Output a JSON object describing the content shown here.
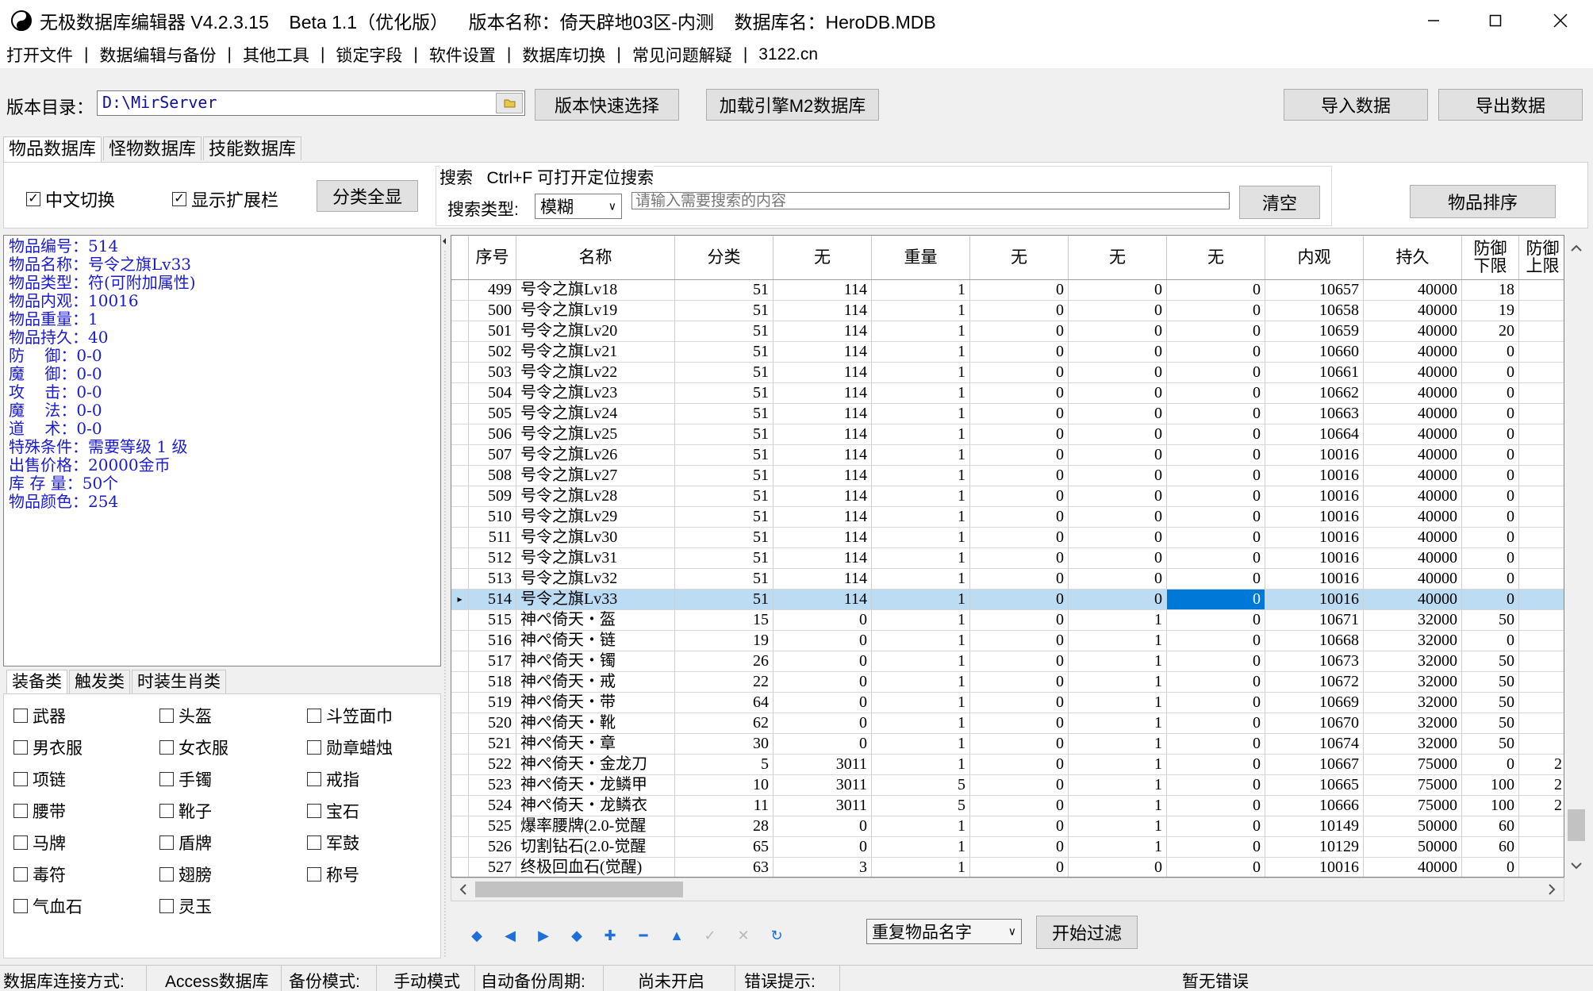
{
  "window": {
    "title": "无极数据库编辑器 V4.2.3.15    Beta 1.1（优化版）    版本名称：倚天辟地03区-内测    数据库名：HeroDB.MDB"
  },
  "menu": [
    "打开文件",
    "数据编辑与备份",
    "其他工具",
    "锁定字段",
    "软件设置",
    "数据库切换",
    "常见问题解疑",
    "3122.cn"
  ],
  "toolbar": {
    "dir_label": "版本目录：",
    "dir_value": "D:\\MirServer",
    "quick_select": "版本快速选择",
    "load_m2": "加载引擎M2数据库",
    "import": "导入数据",
    "export": "导出数据"
  },
  "db_tabs": [
    "物品数据库",
    "怪物数据库",
    "技能数据库"
  ],
  "options": {
    "chinese_switch": "中文切换",
    "show_ext": "显示扩展栏",
    "show_all_cats": "分类全显",
    "search_title": "搜索   Ctrl+F 可打开定位搜索",
    "search_type_label": "搜索类型:",
    "search_type_value": "模糊",
    "search_placeholder": "请输入需要搜索的内容",
    "clear": "清空",
    "sort": "物品排序"
  },
  "item_info": [
    "物品编号：514",
    "物品名称：号令之旗Lv33",
    "物品类型：符(可附加属性)",
    "物品内观：10016",
    "物品重量：1",
    "物品持久：40",
    "防    御：0-0",
    "魔    御：0-0",
    "攻    击：0-0",
    "魔    法：0-0",
    "道    术：0-0",
    "特殊条件：需要等级 1 级",
    "出售价格：20000金币",
    "库 存 量：50个",
    "物品颜色：254"
  ],
  "cat_tabs": [
    "装备类",
    "触发类",
    "时装生肖类"
  ],
  "categories": [
    [
      "武器",
      "头盔",
      "斗笠面巾"
    ],
    [
      "男衣服",
      "女衣服",
      "勋章蜡烛"
    ],
    [
      "项链",
      "手镯",
      "戒指"
    ],
    [
      "腰带",
      "靴子",
      "宝石"
    ],
    [
      "马牌",
      "盾牌",
      "军鼓"
    ],
    [
      "毒符",
      "翅膀",
      "称号"
    ],
    [
      "气血石",
      "灵玉",
      ""
    ]
  ],
  "grid": {
    "columns": [
      "序号",
      "名称",
      "分类",
      "无",
      "重量",
      "无",
      "无",
      "无",
      "内观",
      "持久",
      "防御\n下限",
      "防御\n上限"
    ],
    "rows": [
      [
        "499",
        "号令之旗Lv18",
        "51",
        "114",
        "1",
        "0",
        "0",
        "0",
        "10657",
        "40000",
        "18",
        ""
      ],
      [
        "500",
        "号令之旗Lv19",
        "51",
        "114",
        "1",
        "0",
        "0",
        "0",
        "10658",
        "40000",
        "19",
        ""
      ],
      [
        "501",
        "号令之旗Lv20",
        "51",
        "114",
        "1",
        "0",
        "0",
        "0",
        "10659",
        "40000",
        "20",
        ""
      ],
      [
        "502",
        "号令之旗Lv21",
        "51",
        "114",
        "1",
        "0",
        "0",
        "0",
        "10660",
        "40000",
        "0",
        ""
      ],
      [
        "503",
        "号令之旗Lv22",
        "51",
        "114",
        "1",
        "0",
        "0",
        "0",
        "10661",
        "40000",
        "0",
        ""
      ],
      [
        "504",
        "号令之旗Lv23",
        "51",
        "114",
        "1",
        "0",
        "0",
        "0",
        "10662",
        "40000",
        "0",
        ""
      ],
      [
        "505",
        "号令之旗Lv24",
        "51",
        "114",
        "1",
        "0",
        "0",
        "0",
        "10663",
        "40000",
        "0",
        ""
      ],
      [
        "506",
        "号令之旗Lv25",
        "51",
        "114",
        "1",
        "0",
        "0",
        "0",
        "10664",
        "40000",
        "0",
        ""
      ],
      [
        "507",
        "号令之旗Lv26",
        "51",
        "114",
        "1",
        "0",
        "0",
        "0",
        "10016",
        "40000",
        "0",
        ""
      ],
      [
        "508",
        "号令之旗Lv27",
        "51",
        "114",
        "1",
        "0",
        "0",
        "0",
        "10016",
        "40000",
        "0",
        ""
      ],
      [
        "509",
        "号令之旗Lv28",
        "51",
        "114",
        "1",
        "0",
        "0",
        "0",
        "10016",
        "40000",
        "0",
        ""
      ],
      [
        "510",
        "号令之旗Lv29",
        "51",
        "114",
        "1",
        "0",
        "0",
        "0",
        "10016",
        "40000",
        "0",
        ""
      ],
      [
        "511",
        "号令之旗Lv30",
        "51",
        "114",
        "1",
        "0",
        "0",
        "0",
        "10016",
        "40000",
        "0",
        ""
      ],
      [
        "512",
        "号令之旗Lv31",
        "51",
        "114",
        "1",
        "0",
        "0",
        "0",
        "10016",
        "40000",
        "0",
        ""
      ],
      [
        "513",
        "号令之旗Lv32",
        "51",
        "114",
        "1",
        "0",
        "0",
        "0",
        "10016",
        "40000",
        "0",
        ""
      ],
      [
        "514",
        "号令之旗Lv33",
        "51",
        "114",
        "1",
        "0",
        "0",
        "0",
        "10016",
        "40000",
        "0",
        ""
      ],
      [
        "515",
        "神ぺ倚天・盔",
        "15",
        "0",
        "1",
        "0",
        "1",
        "0",
        "10671",
        "32000",
        "50",
        ""
      ],
      [
        "516",
        "神ぺ倚天・链",
        "19",
        "0",
        "1",
        "0",
        "1",
        "0",
        "10668",
        "32000",
        "0",
        ""
      ],
      [
        "517",
        "神ぺ倚天・镯",
        "26",
        "0",
        "1",
        "0",
        "1",
        "0",
        "10673",
        "32000",
        "50",
        ""
      ],
      [
        "518",
        "神ぺ倚天・戒",
        "22",
        "0",
        "1",
        "0",
        "1",
        "0",
        "10672",
        "32000",
        "50",
        ""
      ],
      [
        "519",
        "神ぺ倚天・带",
        "64",
        "0",
        "1",
        "0",
        "1",
        "0",
        "10669",
        "32000",
        "50",
        ""
      ],
      [
        "520",
        "神ぺ倚天・靴",
        "62",
        "0",
        "1",
        "0",
        "1",
        "0",
        "10670",
        "32000",
        "50",
        ""
      ],
      [
        "521",
        "神ぺ倚天・章",
        "30",
        "0",
        "1",
        "0",
        "1",
        "0",
        "10674",
        "32000",
        "50",
        ""
      ],
      [
        "522",
        "神ぺ倚天・金龙刀",
        "5",
        "3011",
        "1",
        "0",
        "1",
        "0",
        "10667",
        "75000",
        "0",
        "2"
      ],
      [
        "523",
        "神ぺ倚天・龙鳞甲",
        "10",
        "3011",
        "5",
        "0",
        "1",
        "0",
        "10665",
        "75000",
        "100",
        "2"
      ],
      [
        "524",
        "神ぺ倚天・龙鳞衣",
        "11",
        "3011",
        "5",
        "0",
        "1",
        "0",
        "10666",
        "75000",
        "100",
        "2"
      ],
      [
        "525",
        "爆率腰牌(2.0-觉醒",
        "28",
        "0",
        "1",
        "0",
        "1",
        "0",
        "10149",
        "50000",
        "60",
        ""
      ],
      [
        "526",
        "切割钻石(2.0-觉醒",
        "65",
        "0",
        "1",
        "0",
        "1",
        "0",
        "10129",
        "50000",
        "60",
        ""
      ],
      [
        "527",
        "终极回血石(觉醒)",
        "63",
        "3",
        "1",
        "0",
        "0",
        "0",
        "10016",
        "40000",
        "0",
        ""
      ]
    ],
    "selected_row": 15
  },
  "filter": {
    "select_value": "重复物品名字",
    "start": "开始过滤"
  },
  "status": {
    "conn_label": "数据库连接方式:",
    "conn_value": "Access数据库",
    "backup_label": "备份模式:",
    "backup_value": "手动模式",
    "auto_label": "自动备份周期:",
    "auto_value": "尚未开启",
    "err_label": "错误提示:",
    "err_value": "暂无错误"
  }
}
